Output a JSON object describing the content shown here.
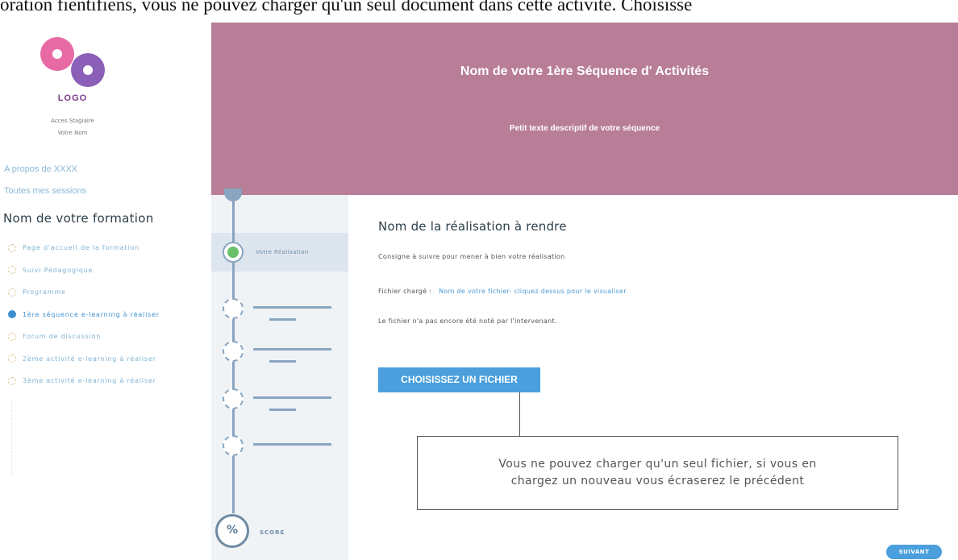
{
  "top_text": "oration fientifiens, vous ne pouvez charger qu'un seul document dans cette activité. Choisisse",
  "sidebar": {
    "logo_text": "LOGO",
    "acces": "Acces Stagiaire",
    "name": "Votre Nom",
    "about_link": "A propos de XXXX",
    "sessions_link": "Toutes mes sessions",
    "formation_title": "Nom de votre formation",
    "items": [
      {
        "label": "Page d'accueil de la formation"
      },
      {
        "label": "Suivi Pédagogique"
      },
      {
        "label": "Programme"
      },
      {
        "label": "1ère séquence e-learning à réaliser"
      },
      {
        "label": "Forum de discussion"
      },
      {
        "label": "2ème activité e-learning à réaliser"
      },
      {
        "label": "3ème activité e-learning à réaliser"
      }
    ],
    "active_index": 3
  },
  "banner": {
    "title": "Nom de votre 1ère Séquence d' Activités",
    "subtitle": "Petit texte descriptif de votre séquence",
    "color": "#b87d97"
  },
  "progress": {
    "active_step_label": "Votre Réalisation",
    "score_symbol": "%",
    "score_label": "SCORE"
  },
  "main": {
    "title": "Nom de la réalisation à rendre",
    "consigne": "Consigne à suivre pour mener à bien votre réalisation",
    "fichier_label": "Fichier chargé :",
    "fichier_link": "Nom de votre fichier- cliquez dessus pour le visualiser",
    "not_graded": "Le fichier n'a pas encore été noté par l'intervenant.",
    "choose_button": "CHOISISSEZ UN FICHIER",
    "callout_line1": "Vous ne pouvez charger qu'un seul fichier, si vous en",
    "callout_line2": "chargez un nouveau vous écraserez le précédent",
    "next_button": "SUIVANT"
  },
  "colors": {
    "accent": "#4a9fdc",
    "rail": "#8aa5bf",
    "active_step": "#6abf69"
  }
}
